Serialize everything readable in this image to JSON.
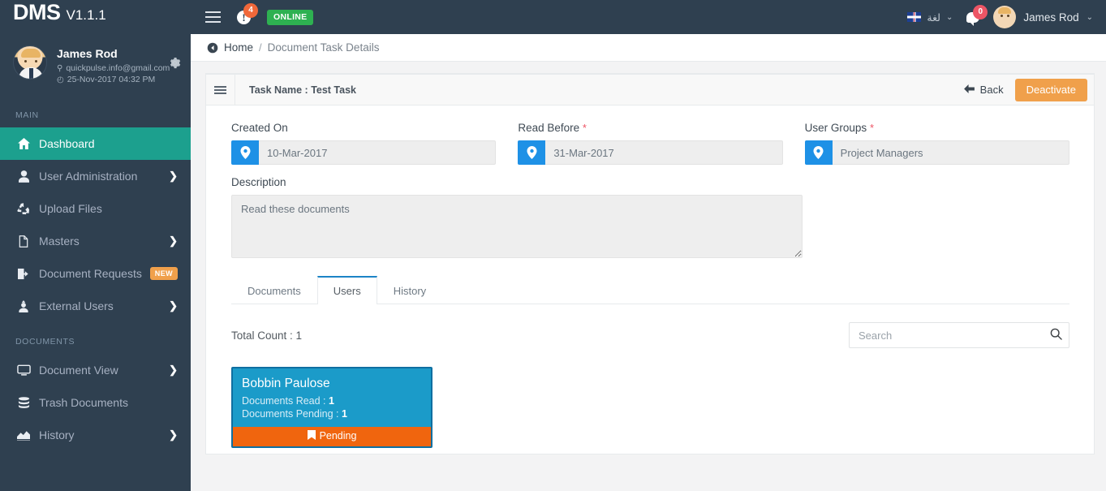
{
  "topbar": {
    "brand_name": "DMS",
    "version": "V1.1.1",
    "menu_icon": "hamburger-icon",
    "alert_icon": "exclamation-circle-icon",
    "alert_badge": "4",
    "online_label": "ONLINE",
    "lang_flag": "uk-flag-icon",
    "lang_label": "لغة",
    "lang_caret": "⌄",
    "chat_icon": "chat-bubble-icon",
    "chat_badge": "0",
    "user_name": "James Rod",
    "user_caret": "⌄"
  },
  "sidebar": {
    "profile": {
      "name": "James Rod",
      "email_icon": "location-pin-icon",
      "email": "quickpulse.info@gmail.com",
      "time_icon": "clock-icon",
      "time": "25-Nov-2017 04:32 PM",
      "gear_icon": "gear-icon",
      "gear_glyph": "✿"
    },
    "sections": [
      {
        "header": "MAIN",
        "items": [
          {
            "label": "Dashboard",
            "icon": "home-icon",
            "active": true,
            "chevron": "",
            "badge": ""
          },
          {
            "label": "User Administration",
            "icon": "user-icon",
            "active": false,
            "chevron": "❯",
            "badge": ""
          },
          {
            "label": "Upload Files",
            "icon": "upload-cloud-icon",
            "active": false,
            "chevron": "",
            "badge": ""
          },
          {
            "label": "Masters",
            "icon": "file-icon",
            "active": false,
            "chevron": "❯",
            "badge": ""
          },
          {
            "label": "Document Requests",
            "icon": "document-request-icon",
            "active": false,
            "chevron": "",
            "badge": "NEW"
          },
          {
            "label": "External Users",
            "icon": "external-user-icon",
            "active": false,
            "chevron": "❯",
            "badge": ""
          }
        ]
      },
      {
        "header": "DOCUMENTS",
        "items": [
          {
            "label": "Document View",
            "icon": "monitor-icon",
            "active": false,
            "chevron": "❯",
            "badge": ""
          },
          {
            "label": "Trash Documents",
            "icon": "database-icon",
            "active": false,
            "chevron": "",
            "badge": ""
          },
          {
            "label": "History",
            "icon": "chart-icon",
            "active": false,
            "chevron": "❯",
            "badge": ""
          }
        ]
      }
    ]
  },
  "breadcrumb": {
    "home_icon": "home-circle-icon",
    "home": "Home",
    "separator": "/",
    "current": "Document Task Details"
  },
  "card": {
    "menu_icon": "card-menu-icon",
    "title": "Task Name : Test Task",
    "back_icon": "arrow-left-icon",
    "back_label": "Back",
    "deactivate_label": "Deactivate"
  },
  "form": {
    "created_on": {
      "label": "Created On",
      "required": "",
      "icon": "location-pin-icon",
      "value": "10-Mar-2017"
    },
    "read_before": {
      "label": "Read Before",
      "required": "*",
      "icon": "location-pin-icon",
      "value": "31-Mar-2017"
    },
    "user_groups": {
      "label": "User Groups",
      "required": "*",
      "icon": "location-pin-icon",
      "value": "Project Managers"
    },
    "description": {
      "label": "Description",
      "value": "Read these documents"
    }
  },
  "tabs": [
    {
      "label": "Documents",
      "active": false
    },
    {
      "label": "Users",
      "active": true
    },
    {
      "label": "History",
      "active": false
    }
  ],
  "users_panel": {
    "total_count": "Total Count : 1",
    "search_placeholder": "Search",
    "search_value": "",
    "search_icon": "search-icon",
    "cards": [
      {
        "name": "Bobbin Paulose",
        "read_label": "Documents Read :",
        "read_value": "1",
        "pending_label": "Documents Pending :",
        "pending_value": "1",
        "status_icon": "bookmark-icon",
        "status": "Pending"
      }
    ]
  },
  "colors": {
    "navy": "#2f4050",
    "teal": "#1ca08e",
    "orange": "#f0a04b",
    "blue_accent": "#1e91e6",
    "tab_blue": "#1c84c6",
    "card_blue": "#1b9bc9",
    "status_orange": "#f0650e",
    "online_green": "#2eb151",
    "required_red": "#ed5565"
  }
}
